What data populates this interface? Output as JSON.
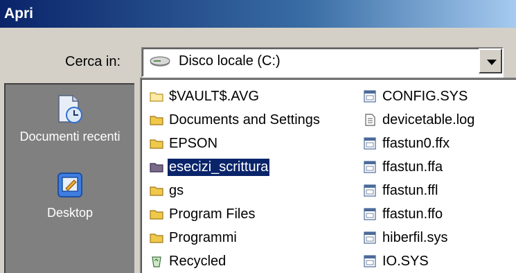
{
  "window": {
    "title": "Apri"
  },
  "look_in": {
    "label": "Cerca in:",
    "value": "Disco locale (C:)",
    "icon": "drive-icon"
  },
  "places": [
    {
      "label": "Documenti recenti",
      "icon": "recent-documents-icon"
    },
    {
      "label": "Desktop",
      "icon": "desktop-icon"
    }
  ],
  "files": {
    "column1": [
      {
        "name": "$VAULT$.AVG",
        "icon": "folder-icon"
      },
      {
        "name": "Documents and Settings",
        "icon": "folder-icon"
      },
      {
        "name": "EPSON",
        "icon": "folder-icon"
      },
      {
        "name": "esecizi_scrittura",
        "icon": "folder-icon",
        "selected": true
      },
      {
        "name": "gs",
        "icon": "folder-icon"
      },
      {
        "name": "Program Files",
        "icon": "folder-icon"
      },
      {
        "name": "Programmi",
        "icon": "folder-icon"
      },
      {
        "name": "Recycled",
        "icon": "recycle-bin-icon"
      }
    ],
    "column2": [
      {
        "name": "CONFIG.SYS",
        "icon": "system-file-icon"
      },
      {
        "name": "devicetable.log",
        "icon": "text-file-icon"
      },
      {
        "name": "ffastun0.ffx",
        "icon": "system-file-icon"
      },
      {
        "name": "ffastun.ffa",
        "icon": "system-file-icon"
      },
      {
        "name": "ffastun.ffl",
        "icon": "system-file-icon"
      },
      {
        "name": "ffastun.ffo",
        "icon": "system-file-icon"
      },
      {
        "name": "hiberfil.sys",
        "icon": "system-file-icon"
      },
      {
        "name": "IO.SYS",
        "icon": "system-file-icon"
      }
    ]
  },
  "colors": {
    "selection": "#0a246a",
    "title_start": "#0a246a",
    "title_end": "#a6caf0",
    "places_bg": "#808080",
    "folder": "#f0c84a"
  }
}
